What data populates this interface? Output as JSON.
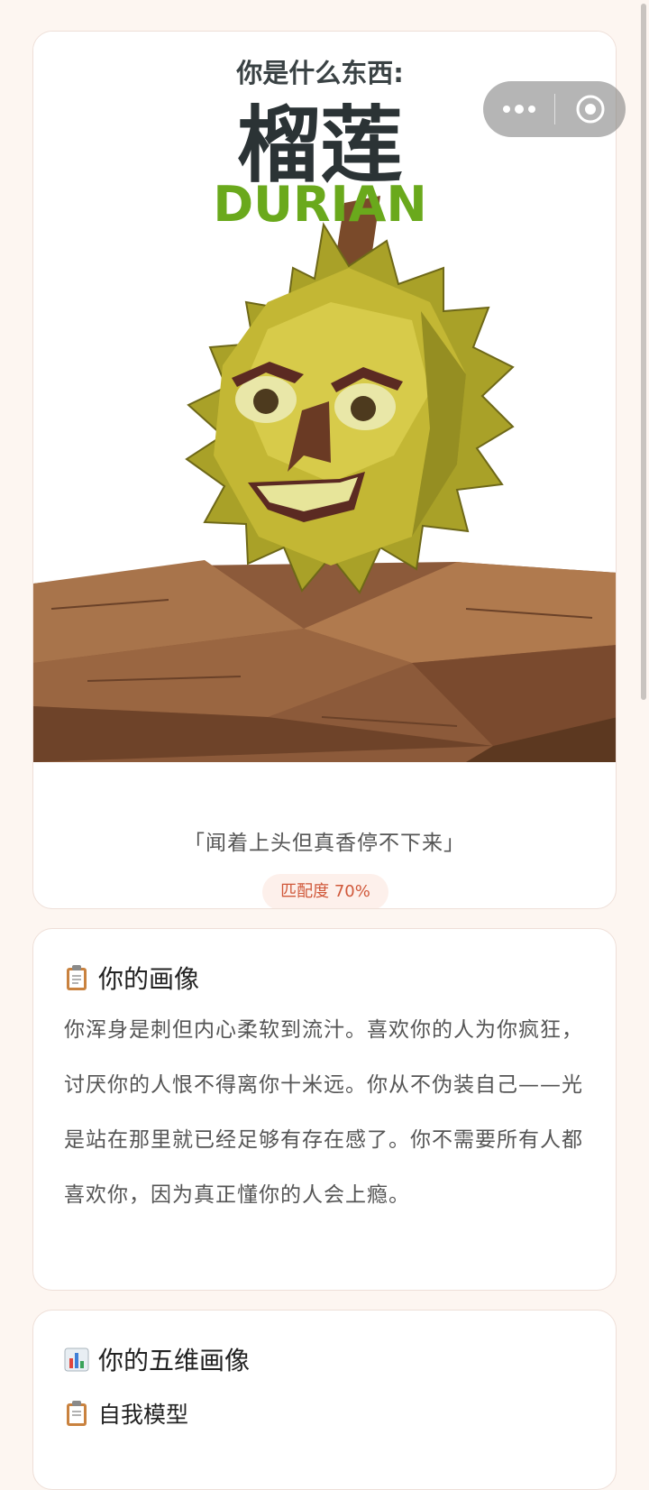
{
  "result": {
    "title_prefix": "你是什么东西:",
    "name_cn": "榴莲",
    "name_en": "DURIAN",
    "quote": "「闻着上头但真香停不下来」",
    "match": "匹配度 70%"
  },
  "portrait": {
    "icon": "clipboard-icon",
    "title": "你的画像",
    "text": "你浑身是刺但内心柔软到流汁。喜欢你的人为你疯狂，讨厌你的人恨不得离你十米远。你从不伪装自己——光是站在那里就已经足够有存在感了。你不需要所有人都喜欢你，因为真正懂你的人会上瘾。"
  },
  "five_dim": {
    "icon": "bar-chart-icon",
    "title": "你的五维画像",
    "sub_icon": "clipboard-icon",
    "sub_title": "自我模型"
  },
  "capsule": {
    "more_icon": "more-dots-icon",
    "close_icon": "target-close-icon"
  },
  "colors": {
    "background": "#fdf6f1",
    "badge_text": "#d0583a",
    "durian_green": "#6aa91c",
    "title_dark": "#2b3335"
  }
}
